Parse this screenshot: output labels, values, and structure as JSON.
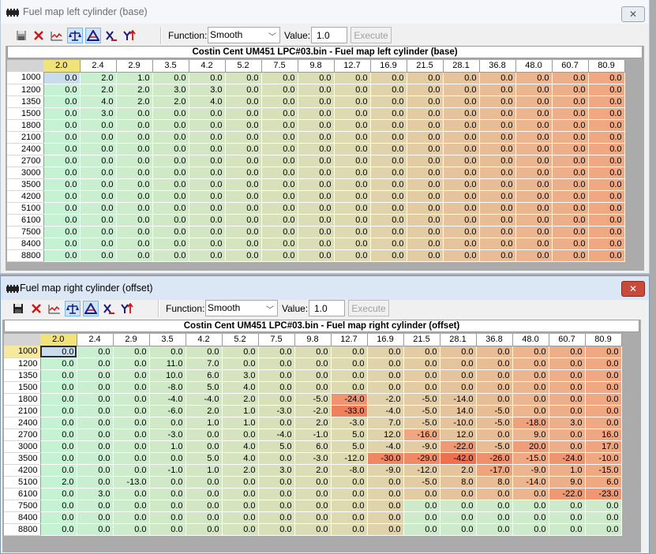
{
  "left_window": {
    "title": "Fuel map left cylinder  (base)",
    "close_label": "✕",
    "function_label": "Function:",
    "function_value": "Smooth",
    "value_label": "Value:",
    "value_value": "1.0",
    "execute_label": "Execute",
    "map_title": "Costin Cent UM451 LPC#03.bin - Fuel map left cylinder  (base)",
    "columns": [
      "2.0",
      "2.4",
      "2.9",
      "3.5",
      "4.2",
      "5.2",
      "7.5",
      "9.8",
      "12.7",
      "16.9",
      "21.5",
      "28.1",
      "36.8",
      "48.0",
      "60.7",
      "80.9"
    ],
    "rows": [
      {
        "rpm": "1000",
        "cells": [
          "0.0",
          "2.0",
          "1.0",
          "0.0",
          "0.0",
          "0.0",
          "0.0",
          "0.0",
          "0.0",
          "0.0",
          "0.0",
          "0.0",
          "0.0",
          "0.0",
          "0.0",
          "0.0"
        ]
      },
      {
        "rpm": "1200",
        "cells": [
          "0.0",
          "2.0",
          "2.0",
          "3.0",
          "3.0",
          "0.0",
          "0.0",
          "0.0",
          "0.0",
          "0.0",
          "0.0",
          "0.0",
          "0.0",
          "0.0",
          "0.0",
          "0.0"
        ]
      },
      {
        "rpm": "1350",
        "cells": [
          "0.0",
          "4.0",
          "2.0",
          "2.0",
          "4.0",
          "0.0",
          "0.0",
          "0.0",
          "0.0",
          "0.0",
          "0.0",
          "0.0",
          "0.0",
          "0.0",
          "0.0",
          "0.0"
        ]
      },
      {
        "rpm": "1500",
        "cells": [
          "0.0",
          "3.0",
          "0.0",
          "0.0",
          "0.0",
          "0.0",
          "0.0",
          "0.0",
          "0.0",
          "0.0",
          "0.0",
          "0.0",
          "0.0",
          "0.0",
          "0.0",
          "0.0"
        ]
      },
      {
        "rpm": "1800",
        "cells": [
          "0.0",
          "0.0",
          "0.0",
          "0.0",
          "0.0",
          "0.0",
          "0.0",
          "0.0",
          "0.0",
          "0.0",
          "0.0",
          "0.0",
          "0.0",
          "0.0",
          "0.0",
          "0.0"
        ]
      },
      {
        "rpm": "2100",
        "cells": [
          "0.0",
          "0.0",
          "0.0",
          "0.0",
          "0.0",
          "0.0",
          "0.0",
          "0.0",
          "0.0",
          "0.0",
          "0.0",
          "0.0",
          "0.0",
          "0.0",
          "0.0",
          "0.0"
        ]
      },
      {
        "rpm": "2400",
        "cells": [
          "0.0",
          "0.0",
          "0.0",
          "0.0",
          "0.0",
          "0.0",
          "0.0",
          "0.0",
          "0.0",
          "0.0",
          "0.0",
          "0.0",
          "0.0",
          "0.0",
          "0.0",
          "0.0"
        ]
      },
      {
        "rpm": "2700",
        "cells": [
          "0.0",
          "0.0",
          "0.0",
          "0.0",
          "0.0",
          "0.0",
          "0.0",
          "0.0",
          "0.0",
          "0.0",
          "0.0",
          "0.0",
          "0.0",
          "0.0",
          "0.0",
          "0.0"
        ]
      },
      {
        "rpm": "3000",
        "cells": [
          "0.0",
          "0.0",
          "0.0",
          "0.0",
          "0.0",
          "0.0",
          "0.0",
          "0.0",
          "0.0",
          "0.0",
          "0.0",
          "0.0",
          "0.0",
          "0.0",
          "0.0",
          "0.0"
        ]
      },
      {
        "rpm": "3500",
        "cells": [
          "0.0",
          "0.0",
          "0.0",
          "0.0",
          "0.0",
          "0.0",
          "0.0",
          "0.0",
          "0.0",
          "0.0",
          "0.0",
          "0.0",
          "0.0",
          "0.0",
          "0.0",
          "0.0"
        ]
      },
      {
        "rpm": "4200",
        "cells": [
          "0.0",
          "0.0",
          "0.0",
          "0.0",
          "0.0",
          "0.0",
          "0.0",
          "0.0",
          "0.0",
          "0.0",
          "0.0",
          "0.0",
          "0.0",
          "0.0",
          "0.0",
          "0.0"
        ]
      },
      {
        "rpm": "5100",
        "cells": [
          "0.0",
          "0.0",
          "0.0",
          "0.0",
          "0.0",
          "0.0",
          "0.0",
          "0.0",
          "0.0",
          "0.0",
          "0.0",
          "0.0",
          "0.0",
          "0.0",
          "0.0",
          "0.0"
        ]
      },
      {
        "rpm": "6100",
        "cells": [
          "0.0",
          "0.0",
          "0.0",
          "0.0",
          "0.0",
          "0.0",
          "0.0",
          "0.0",
          "0.0",
          "0.0",
          "0.0",
          "0.0",
          "0.0",
          "0.0",
          "0.0",
          "0.0"
        ]
      },
      {
        "rpm": "7500",
        "cells": [
          "0.0",
          "0.0",
          "0.0",
          "0.0",
          "0.0",
          "0.0",
          "0.0",
          "0.0",
          "0.0",
          "0.0",
          "0.0",
          "0.0",
          "0.0",
          "0.0",
          "0.0",
          "0.0"
        ]
      },
      {
        "rpm": "8400",
        "cells": [
          "0.0",
          "0.0",
          "0.0",
          "0.0",
          "0.0",
          "0.0",
          "0.0",
          "0.0",
          "0.0",
          "0.0",
          "0.0",
          "0.0",
          "0.0",
          "0.0",
          "0.0",
          "0.0"
        ]
      },
      {
        "rpm": "8800",
        "cells": [
          "0.0",
          "0.0",
          "0.0",
          "0.0",
          "0.0",
          "0.0",
          "0.0",
          "0.0",
          "0.0",
          "0.0",
          "0.0",
          "0.0",
          "0.0",
          "0.0",
          "0.0",
          "0.0"
        ]
      }
    ]
  },
  "right_window": {
    "title": "Fuel map right cylinder (offset)",
    "close_label": "✕",
    "function_label": "Function:",
    "function_value": "Smooth",
    "value_label": "Value:",
    "value_value": "1.0",
    "execute_label": "Execute",
    "map_title": "Costin Cent UM451 LPC#03.bin - Fuel map right cylinder (offset)",
    "columns": [
      "2.0",
      "2.4",
      "2.9",
      "3.5",
      "4.2",
      "5.2",
      "7.5",
      "9.8",
      "12.7",
      "16.9",
      "21.5",
      "28.1",
      "36.8",
      "48.0",
      "60.7",
      "80.9"
    ],
    "rows": [
      {
        "rpm": "1000",
        "cells": [
          "0.0",
          "0.0",
          "0.0",
          "0.0",
          "0.0",
          "0.0",
          "0.0",
          "0.0",
          "0.0",
          "0.0",
          "0.0",
          "0.0",
          "0.0",
          "0.0",
          "0.0",
          "0.0"
        ]
      },
      {
        "rpm": "1200",
        "cells": [
          "0.0",
          "0.0",
          "0.0",
          "11.0",
          "7.0",
          "0.0",
          "0.0",
          "0.0",
          "0.0",
          "0.0",
          "0.0",
          "0.0",
          "0.0",
          "0.0",
          "0.0",
          "0.0"
        ]
      },
      {
        "rpm": "1350",
        "cells": [
          "0.0",
          "0.0",
          "0.0",
          "10.0",
          "6.0",
          "3.0",
          "0.0",
          "0.0",
          "0.0",
          "0.0",
          "0.0",
          "0.0",
          "0.0",
          "0.0",
          "0.0",
          "0.0"
        ]
      },
      {
        "rpm": "1500",
        "cells": [
          "0.0",
          "0.0",
          "0.0",
          "-8.0",
          "5.0",
          "4.0",
          "0.0",
          "0.0",
          "0.0",
          "0.0",
          "0.0",
          "0.0",
          "0.0",
          "0.0",
          "0.0",
          "0.0"
        ]
      },
      {
        "rpm": "1800",
        "cells": [
          "0.0",
          "0.0",
          "0.0",
          "-4.0",
          "-4.0",
          "2.0",
          "0.0",
          "-5.0",
          "-24.0",
          "-2.0",
          "-5.0",
          "-14.0",
          "0.0",
          "0.0",
          "0.0",
          "0.0"
        ]
      },
      {
        "rpm": "2100",
        "cells": [
          "0.0",
          "0.0",
          "0.0",
          "-6.0",
          "2.0",
          "1.0",
          "-3.0",
          "-2.0",
          "-33.0",
          "-4.0",
          "-5.0",
          "14.0",
          "-5.0",
          "0.0",
          "0.0",
          "0.0"
        ]
      },
      {
        "rpm": "2400",
        "cells": [
          "0.0",
          "0.0",
          "0.0",
          "0.0",
          "1.0",
          "1.0",
          "0.0",
          "2.0",
          "-3.0",
          "7.0",
          "-5.0",
          "-10.0",
          "-5.0",
          "-18.0",
          "3.0",
          "0.0"
        ]
      },
      {
        "rpm": "2700",
        "cells": [
          "0.0",
          "0.0",
          "0.0",
          "-3.0",
          "0.0",
          "0.0",
          "-4.0",
          "-1.0",
          "5.0",
          "12.0",
          "-16.0",
          "12.0",
          "0.0",
          "9.0",
          "0.0",
          "16.0"
        ]
      },
      {
        "rpm": "3000",
        "cells": [
          "0.0",
          "0.0",
          "0.0",
          "1.0",
          "0.0",
          "4.0",
          "5.0",
          "6.0",
          "5.0",
          "-4.0",
          "-9.0",
          "-22.0",
          "-5.0",
          "20.0",
          "0.0",
          "17.0"
        ]
      },
      {
        "rpm": "3500",
        "cells": [
          "0.0",
          "0.0",
          "0.0",
          "0.0",
          "5.0",
          "4.0",
          "0.0",
          "-3.0",
          "-12.0",
          "-30.0",
          "-29.0",
          "-42.0",
          "-26.0",
          "-15.0",
          "-24.0",
          "-10.0"
        ]
      },
      {
        "rpm": "4200",
        "cells": [
          "0.0",
          "0.0",
          "0.0",
          "-1.0",
          "1.0",
          "2.0",
          "3.0",
          "2.0",
          "-8.0",
          "-9.0",
          "-12.0",
          "2.0",
          "-17.0",
          "-9.0",
          "1.0",
          "-15.0"
        ]
      },
      {
        "rpm": "5100",
        "cells": [
          "2.0",
          "0.0",
          "-13.0",
          "0.0",
          "0.0",
          "0.0",
          "0.0",
          "0.0",
          "0.0",
          "0.0",
          "-5.0",
          "8.0",
          "8.0",
          "-14.0",
          "9.0",
          "6.0"
        ]
      },
      {
        "rpm": "6100",
        "cells": [
          "0.0",
          "3.0",
          "0.0",
          "0.0",
          "0.0",
          "0.0",
          "0.0",
          "0.0",
          "0.0",
          "0.0",
          "0.0",
          "0.0",
          "0.0",
          "0.0",
          "-22.0",
          "-23.0"
        ]
      },
      {
        "rpm": "7500",
        "cells": [
          "0.0",
          "0.0",
          "0.0",
          "0.0",
          "0.0",
          "0.0",
          "0.0",
          "0.0",
          "0.0",
          "0.0",
          "0.0",
          "0.0",
          "0.0",
          "0.0",
          "0.0",
          "0.0"
        ]
      },
      {
        "rpm": "8400",
        "cells": [
          "0.0",
          "0.0",
          "0.0",
          "0.0",
          "0.0",
          "0.0",
          "0.0",
          "0.0",
          "0.0",
          "0.0",
          "0.0",
          "0.0",
          "0.0",
          "0.0",
          "0.0",
          "0.0"
        ]
      },
      {
        "rpm": "8800",
        "cells": [
          "0.0",
          "0.0",
          "0.0",
          "0.0",
          "0.0",
          "0.0",
          "0.0",
          "0.0",
          "0.0",
          "0.0",
          "0.0",
          "0.0",
          "0.0",
          "0.0",
          "0.0",
          "0.0"
        ]
      }
    ]
  },
  "colors": {
    "cool": "#c6f2d4",
    "neutral": "#dcdcb4",
    "warm": "#f0a882",
    "selected_header": "#f2e27a",
    "selected_cell": "#c8dcec"
  }
}
